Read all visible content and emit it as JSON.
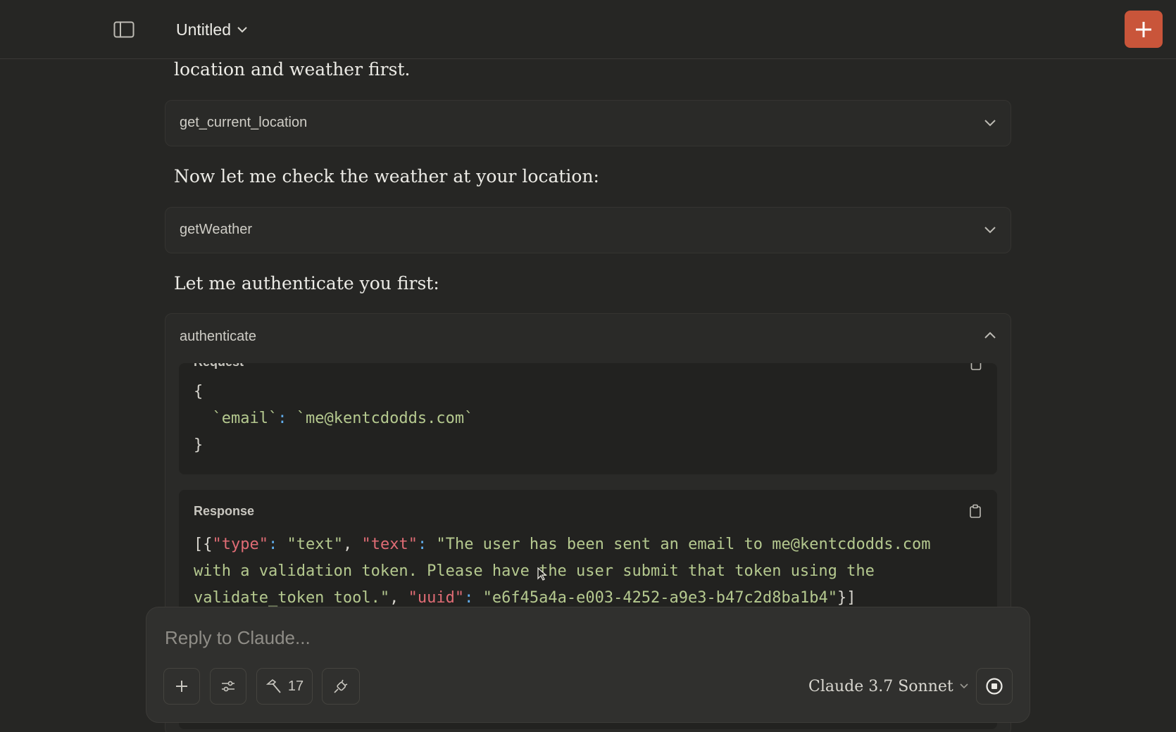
{
  "header": {
    "title": "Untitled"
  },
  "conversation": {
    "text_1": "location and weather first.",
    "tool_1": {
      "name": "get_current_location"
    },
    "text_2": "Now let me check the weather at your location:",
    "tool_2": {
      "name": "getWeather"
    },
    "text_3": "Let me authenticate you first:",
    "tool_3": {
      "name": "authenticate",
      "request_label": "Request",
      "request_code": {
        "open": "{",
        "key": "`email`",
        "colon": ":",
        "value": "`me@kentcdodds.com`",
        "close": "}"
      },
      "response_label": "Response",
      "response_code": {
        "p1": "[{",
        "k1": "\"type\"",
        "c1": ":",
        "v1": "\"text\"",
        "p2": ", ",
        "k2": "\"text\"",
        "c2": ":",
        "v2_line1": "\"The user has been sent an email to me@kentcdodds.com",
        "v2_line2": "with a validation token. Please have the user submit that token using the",
        "v2_line3": "validate_token tool.\"",
        "p3": ", ",
        "k3": "\"uuid\"",
        "c3": ":",
        "v3": "\"e6f45a4a-e003-4252-a9e3-b47c2d8ba1b4\"",
        "p4": "}]"
      }
    }
  },
  "composer": {
    "placeholder": "Reply to Claude...",
    "tools_count": "17",
    "model_name": "Claude 3.7 Sonnet"
  },
  "colors": {
    "accent": "#c9553a",
    "background": "#262624",
    "key": "#e06c75",
    "string": "#b5c98f",
    "colon": "#61afef"
  },
  "icons": {
    "sidebar": "sidebar-toggle-icon",
    "new_chat": "plus-icon",
    "expand": "chevron-down-icon",
    "collapse": "chevron-up-icon",
    "copy": "clipboard-icon",
    "attach": "plus-icon",
    "options": "sliders-icon",
    "tools": "hammer-icon",
    "integrations": "plug-icon",
    "stop": "stop-icon"
  }
}
